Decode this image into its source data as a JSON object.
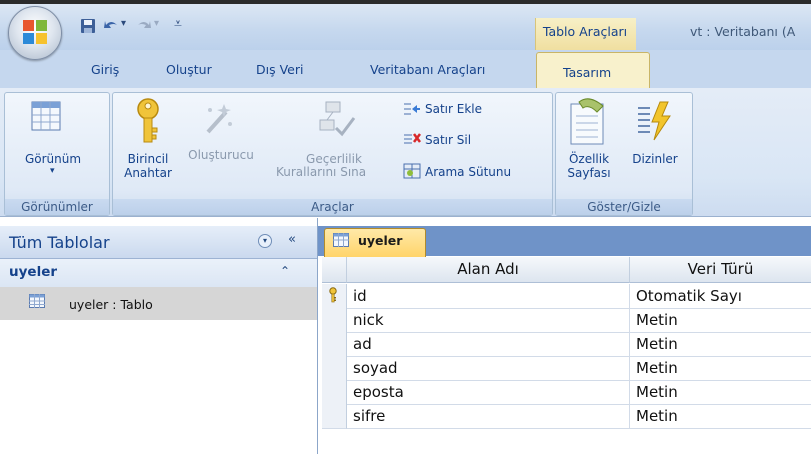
{
  "window": {
    "title": "vt : Veritabanı (A",
    "context_tab_group": "Tablo Araçları"
  },
  "quick_access": {
    "save_icon": "save-icon",
    "undo_icon": "undo-icon",
    "redo_icon": "redo-icon",
    "customize_icon": "customize-qat-icon"
  },
  "ribbon_tabs": [
    "Giriş",
    "Oluştur",
    "Dış Veri",
    "Veritabanı Araçları",
    "Tasarım"
  ],
  "ribbon": {
    "groups": {
      "views": "Görünümler",
      "tools": "Araçlar",
      "show_hide": "Göster/Gizle"
    },
    "buttons": {
      "view": "Görünüm",
      "primary_key_1": "Birincil",
      "primary_key_2": "Anahtar",
      "builder": "Oluşturucu",
      "test_rules_1": "Geçerlilik",
      "test_rules_2": "Kurallarını Sına",
      "insert_row": "Satır Ekle",
      "delete_row": "Satır Sil",
      "lookup_column": "Arama Sütunu",
      "property_sheet_1": "Özellik",
      "property_sheet_2": "Sayfası",
      "indexes": "Dizinler"
    }
  },
  "nav_pane": {
    "title": "Tüm Tablolar",
    "group": "uyeler",
    "item": "uyeler : Tablo"
  },
  "document": {
    "tab_label": "uyeler",
    "columns": [
      "Alan Adı",
      "Veri Türü"
    ],
    "rows": [
      {
        "field": "id",
        "type": "Otomatik Sayı",
        "primary_key": true
      },
      {
        "field": "nick",
        "type": "Metin",
        "primary_key": false
      },
      {
        "field": "ad",
        "type": "Metin",
        "primary_key": false
      },
      {
        "field": "soyad",
        "type": "Metin",
        "primary_key": false
      },
      {
        "field": "eposta",
        "type": "Metin",
        "primary_key": false
      },
      {
        "field": "sifre",
        "type": "Metin",
        "primary_key": false
      }
    ]
  },
  "colors": {
    "accent": "#15428b",
    "context_tab": "#f8f1cc",
    "doc_tab": "#ffd46a"
  }
}
